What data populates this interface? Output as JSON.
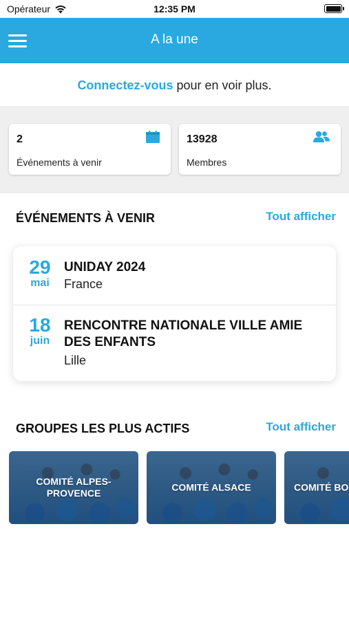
{
  "status_bar": {
    "carrier": "Opérateur",
    "time": "12:35 PM"
  },
  "app_bar": {
    "title": "A la une",
    "menu_icon": "menu-icon"
  },
  "login_banner": {
    "link": "Connectez-vous",
    "rest": " pour en voir plus."
  },
  "stats": [
    {
      "value": "2",
      "label": "Événements à venir",
      "icon": "calendar-icon"
    },
    {
      "value": "13928",
      "label": "Membres",
      "icon": "members-icon"
    }
  ],
  "events_section": {
    "title": "ÉVÉNEMENTS À VENIR",
    "see_all": "Tout afficher",
    "items": [
      {
        "day": "29",
        "month": "mai",
        "title": "UNIDAY 2024",
        "place": "France"
      },
      {
        "day": "18",
        "month": "juin",
        "title": "RENCONTRE NATIONALE VILLE AMIE DES ENFANTS",
        "place": "Lille"
      }
    ]
  },
  "groups_section": {
    "title": "GROUPES LES PLUS ACTIFS",
    "see_all": "Tout afficher",
    "items": [
      {
        "name": "COMITÉ ALPES-PROVENCE"
      },
      {
        "name": "COMITÉ ALSACE"
      },
      {
        "name": "COMITÉ BO"
      }
    ]
  },
  "colors": {
    "accent": "#29a9e0",
    "background_gray": "#efefef"
  }
}
